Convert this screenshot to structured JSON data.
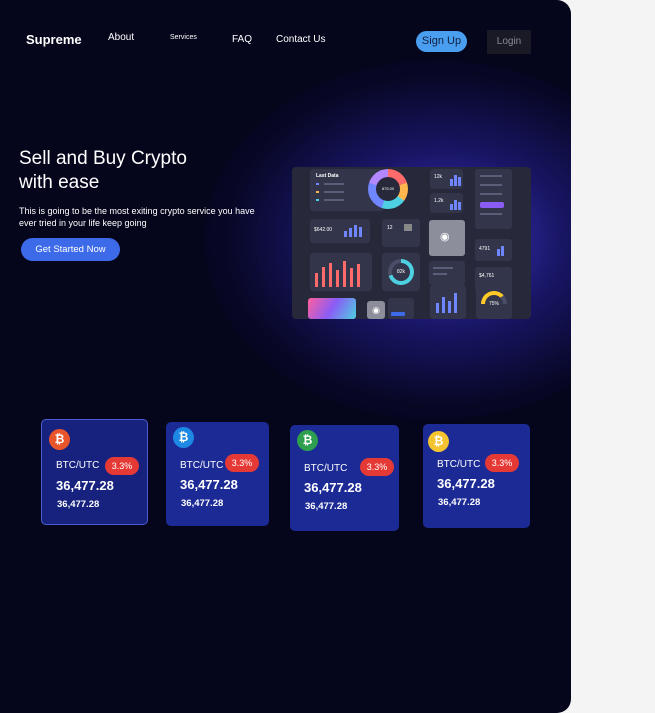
{
  "nav": {
    "brand": "Supreme",
    "links": [
      "About",
      "Services",
      "FAQ",
      "Contact Us"
    ],
    "signup_label": "Sign Up",
    "login_label": "Login"
  },
  "hero": {
    "title_line1": "Sell and Buy Crypto",
    "title_line2": "with ease",
    "subtitle": "This is going to be the most exiting crypto service you have ever tried in your life keep going",
    "cta_label": "Get Started Now"
  },
  "dashboard_preview": {
    "tile_title": "Last Data",
    "donut_value": "875.00",
    "balance": "$642.00",
    "stat_a": "12k",
    "stat_b": "1.2k",
    "stat_c": "12",
    "gauge_value": "82k",
    "value_d": "4791",
    "value_e": "$4,761",
    "gauge_percent": "75%"
  },
  "cards": [
    {
      "icon": "bitcoin-icon",
      "coin_color": "#e8552a",
      "pair": "BTC/UTC",
      "change": "3.3%",
      "price": "36,477.28",
      "price_sub": "36,477.28"
    },
    {
      "icon": "bitcoin-icon",
      "coin_color": "#1e88e5",
      "pair": "BTC/UTC",
      "change": "3.3%",
      "price": "36,477.28",
      "price_sub": "36,477.28"
    },
    {
      "icon": "bitcoin-icon",
      "coin_color": "#2e9e4f",
      "pair": "BTC/UTC",
      "change": "3.3%",
      "price": "36,477.28",
      "price_sub": "36,477.28"
    },
    {
      "icon": "bitcoin-icon",
      "coin_color": "#f4c430",
      "pair": "BTC/UTC",
      "change": "3.3%",
      "price": "36,477.28",
      "price_sub": "36,477.28"
    }
  ]
}
